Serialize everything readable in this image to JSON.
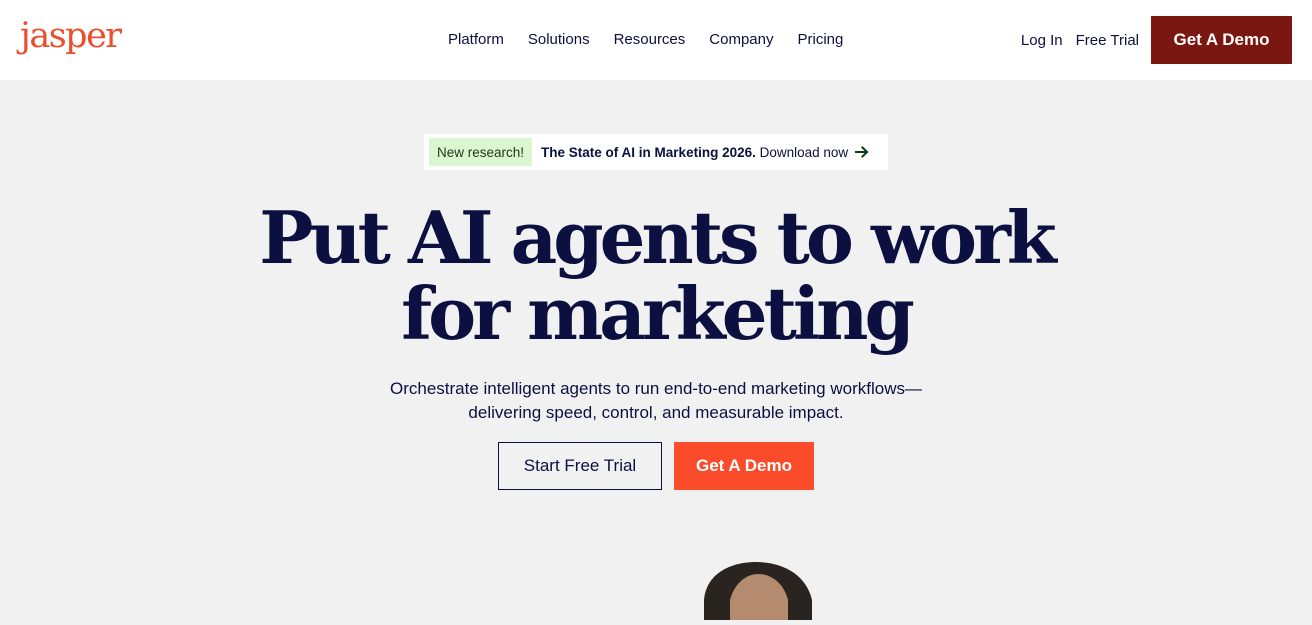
{
  "header": {
    "logo": "jasper",
    "nav": [
      "Platform",
      "Solutions",
      "Resources",
      "Company",
      "Pricing"
    ],
    "login": "Log In",
    "free_trial": "Free Trial",
    "demo": "Get A Demo"
  },
  "announcement": {
    "badge": "New research!",
    "title": "The State of AI in Marketing 2026.",
    "cta": "Download now",
    "icon": "arrow-right-icon"
  },
  "hero": {
    "headline_line1": "Put AI agents to work",
    "headline_line2": "for marketing",
    "subhead_line1": "Orchestrate intelligent agents to run end-to-end marketing workflows—",
    "subhead_line2": "delivering speed, control, and measurable impact.",
    "primary_cta": "Start Free Trial",
    "secondary_cta": "Get A Demo"
  },
  "colors": {
    "brand": "#ea4e2c",
    "navy": "#0b1040",
    "demo_dark": "#7a1710",
    "demo_bright": "#fa4b2a",
    "badge_bg": "#daf6d1",
    "page_bg": "#f1f1f1"
  }
}
